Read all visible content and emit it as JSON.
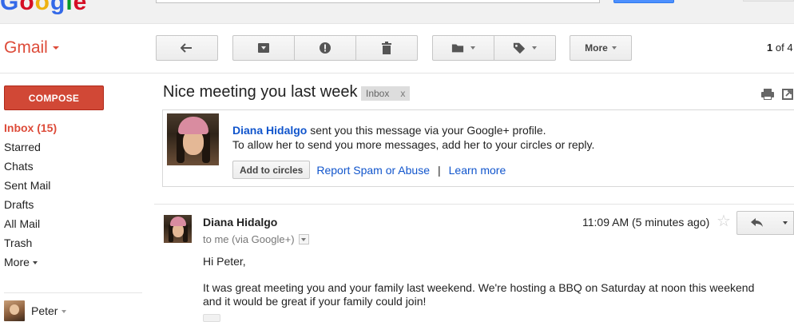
{
  "header": {
    "logo_text": "Google"
  },
  "app": {
    "label": "Gmail"
  },
  "toolbar": {
    "more_label": "More",
    "pager_current": "1",
    "pager_of": "of 4"
  },
  "sidebar": {
    "compose_label": "COMPOSE",
    "items": [
      {
        "label": "Inbox (15)",
        "active": true
      },
      {
        "label": "Starred"
      },
      {
        "label": "Chats"
      },
      {
        "label": "Sent Mail"
      },
      {
        "label": "Drafts"
      },
      {
        "label": "All Mail"
      },
      {
        "label": "Trash"
      },
      {
        "label": "More"
      }
    ],
    "user_name": "Peter"
  },
  "thread": {
    "subject": "Nice meeting you last week",
    "label_chip": "Inbox",
    "label_remove": "x"
  },
  "notice": {
    "sender": "Diana Hidalgo",
    "line1_rest": " sent you this message via your Google+ profile.",
    "line2": "To allow her to send you more messages, add her to your circles or reply.",
    "add_circles": "Add to circles",
    "report_spam": "Report Spam or Abuse",
    "separator": "|",
    "learn_more": "Learn more"
  },
  "message": {
    "sender": "Diana Hidalgo",
    "to": "to me (via Google+)",
    "time": "11:09 AM (5 minutes ago)",
    "body": {
      "greeting": "Hi Peter,",
      "line1": "It was great meeting you and your family last weekend.  We're hosting a BBQ on Saturday at noon this weekend",
      "line2": "and it would be great if your family could join!"
    }
  },
  "colors": {
    "gmail_red": "#dd4b39",
    "compose_red": "#d14836",
    "link_blue": "#15c",
    "search_blue": "#4d90fe"
  },
  "icons": {
    "back": "arrow-left-icon",
    "archive": "archive-icon",
    "spam": "report-spam-icon",
    "delete": "trash-icon",
    "folder": "folder-icon",
    "label": "label-tag-icon",
    "print": "print-icon",
    "new_window": "new-window-icon",
    "star": "star-icon",
    "reply": "reply-icon"
  }
}
